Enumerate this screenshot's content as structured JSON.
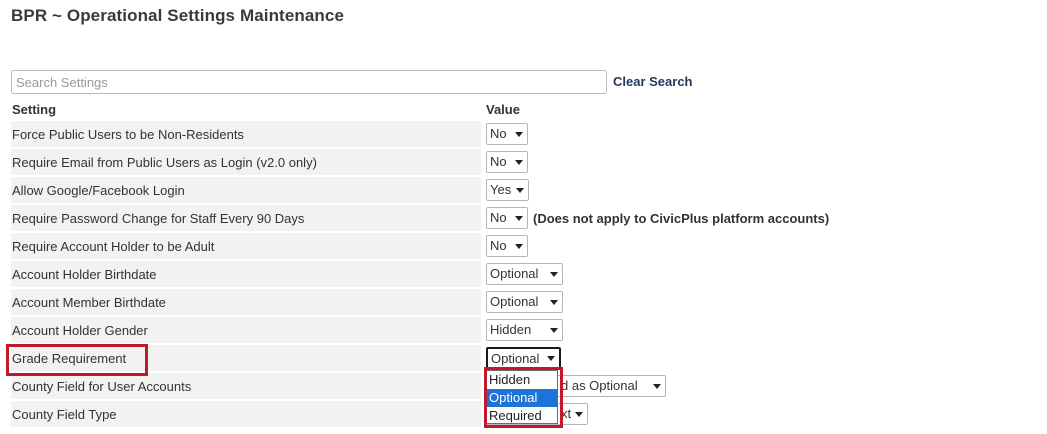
{
  "header": {
    "title": "BPR  ~  Operational Settings Maintenance"
  },
  "search": {
    "placeholder": "Search Settings",
    "value": "",
    "clear_label": "Clear Search"
  },
  "columns": {
    "setting": "Setting",
    "value": "Value"
  },
  "rows": [
    {
      "label": "Force Public Users to be Non-Residents",
      "value": "No"
    },
    {
      "label": "Require Email from Public Users as Login (v2.0 only)",
      "value": "No"
    },
    {
      "label": "Allow Google/Facebook Login",
      "value": "Yes"
    },
    {
      "label": "Require Password Change for Staff Every 90 Days",
      "value": "No",
      "note": "(Does not apply to CivicPlus platform accounts)"
    },
    {
      "label": "Require Account Holder to be Adult",
      "value": "No"
    },
    {
      "label": "Account Holder Birthdate",
      "value": "Optional"
    },
    {
      "label": "Account Member Birthdate",
      "value": "Optional"
    },
    {
      "label": "Account Holder Gender",
      "value": "Hidden"
    },
    {
      "label": "Grade Requirement",
      "value": "Optional"
    },
    {
      "label": "County Field for User Accounts",
      "value": "d as Optional"
    },
    {
      "label": "County Field Type",
      "value": "xt"
    }
  ],
  "grade_dropdown": {
    "options": [
      "Hidden",
      "Optional",
      "Required"
    ],
    "selected": "Optional"
  },
  "colors": {
    "highlight": "#c0192c",
    "selected_option": "#1e73d8"
  }
}
